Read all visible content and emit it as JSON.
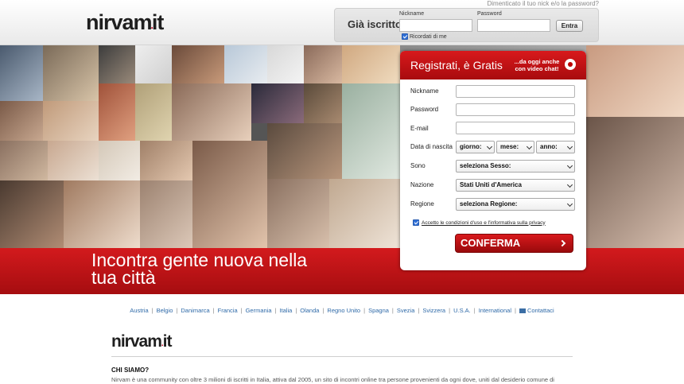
{
  "brand": {
    "logo_pre": "nirvam",
    "logo_dot": ".",
    "logo_post": "it"
  },
  "header": {
    "forgot_link": "Dimenticato il tuo nick e/o la password?",
    "login_title": "Già iscritto",
    "nickname_label": "Nickname",
    "password_label": "Password",
    "enter_button": "Entra",
    "remember_label": "Ricordati di me"
  },
  "banner": {
    "tagline_line1": "Incontra gente nuova nella",
    "tagline_line2": "tua città"
  },
  "register": {
    "title": "Registrati, è Gratis",
    "subtitle_line1": "...da oggi anche",
    "subtitle_line2": "con video chat!",
    "fields": {
      "nickname": "Nickname",
      "password": "Password",
      "email": "E-mail",
      "birthdate": "Data di nascita",
      "gender": "Sono",
      "nation": "Nazione",
      "region": "Regione"
    },
    "day_select": "giorno:",
    "month_select": "mese:",
    "year_select": "anno:",
    "gender_select": "seleziona Sesso:",
    "nation_select": "Stati Uniti d'America",
    "region_select": "seleziona Regione:",
    "terms": "Accetto le condizioni d'uso e l'informativa sulla privacy",
    "confirm_button": "CONFERMA"
  },
  "countries": [
    "Austria",
    "Belgio",
    "Danimarca",
    "Francia",
    "Germania",
    "Italia",
    "Olanda",
    "Regno Unito",
    "Spagna",
    "Svezia",
    "Svizzera",
    "U.S.A.",
    "International"
  ],
  "contact_link": "Contattaci",
  "about": {
    "title": "CHI SIAMO?",
    "text": "Nirvam è una community con oltre 3 milioni di iscritti in Italia, attiva dal 2005, un sito di incontri online tra persone provenienti da ogni dove, uniti dal desiderio comune di"
  },
  "colors": {
    "brand_red": "#c8161a",
    "link_blue": "#2f6aa8"
  }
}
